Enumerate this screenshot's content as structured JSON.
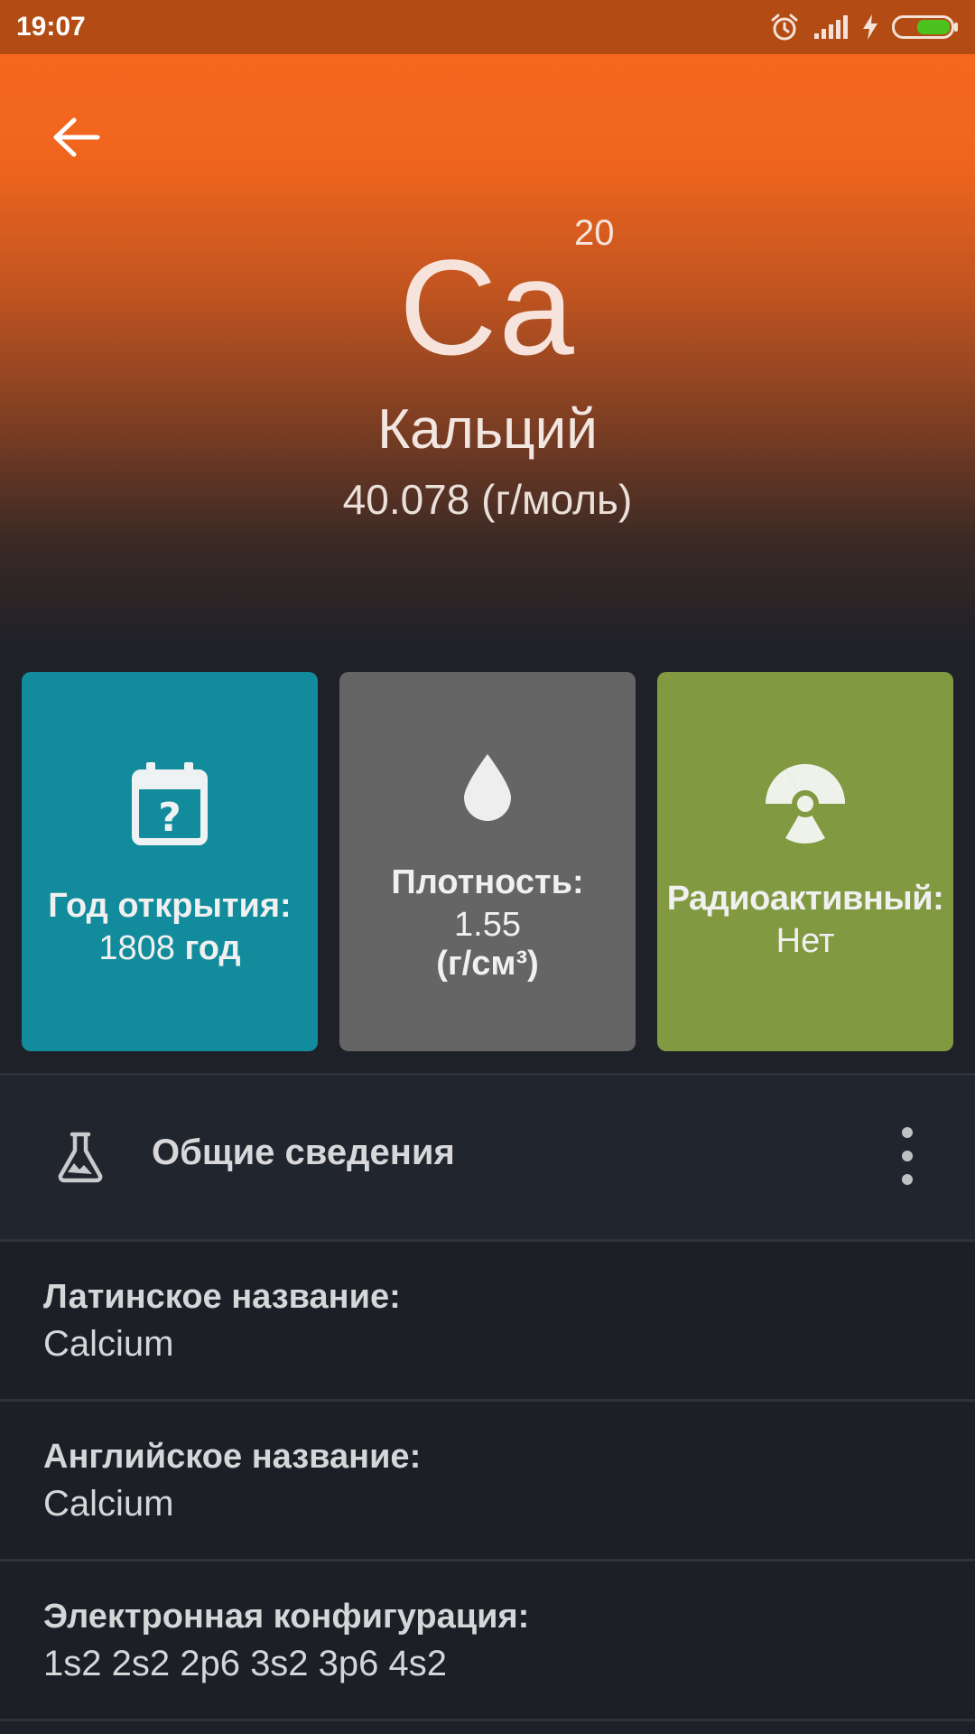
{
  "status_bar": {
    "time": "19:07",
    "icons": [
      "alarm-icon",
      "signal-icon",
      "charging-icon",
      "battery-icon"
    ],
    "battery_color": "#4cc21e"
  },
  "header": {
    "back_icon": "arrow-left-icon",
    "symbol": "Ca",
    "atomic_number": "20",
    "name": "Кальций",
    "atomic_mass": "40.078 (г/моль)",
    "gradient_top_color": "#f5671d"
  },
  "cards": {
    "discovery": {
      "icon": "calendar-question-icon",
      "label": "Год открытия:",
      "value_number": "1808",
      "value_unit": "год",
      "color": "#128c9c"
    },
    "density": {
      "icon": "water-drop-icon",
      "label": "Плотность:",
      "value": "1.55",
      "unit": "(г/см³)",
      "color": "#656565"
    },
    "radioactive": {
      "icon": "radioactive-icon",
      "label": "Радиоактивный:",
      "value": "Нет",
      "color": "#819a42"
    }
  },
  "section": {
    "icon": "flask-icon",
    "title": "Общие сведения",
    "menu_icon": "more-vertical-icon"
  },
  "info": [
    {
      "label": "Латинское название:",
      "value": "Calcium"
    },
    {
      "label": "Английское название:",
      "value": "Calcium"
    },
    {
      "label": "Электронная конфигурация:",
      "value": "1s2 2s2 2p6 3s2 3p6 4s2"
    }
  ]
}
